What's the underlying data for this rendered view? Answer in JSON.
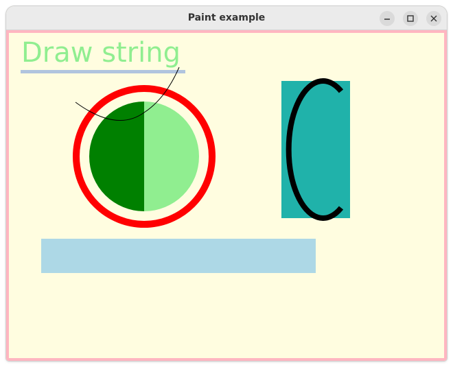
{
  "window": {
    "title": "Paint example"
  },
  "controls": {
    "minimize": "minimize-icon",
    "maximize": "maximize-icon",
    "close": "close-icon"
  },
  "canvas": {
    "text": "Draw string",
    "colors": {
      "background": "#fffde0",
      "border": "#ffb6c1",
      "text": "#90ee90",
      "underline": "#b0c4de",
      "ring": "#ff0000",
      "circle_left": "#008000",
      "circle_right": "#90ee90",
      "rect_fill": "#20b2aa",
      "arc": "#000000",
      "bar": "#add8e6"
    }
  }
}
